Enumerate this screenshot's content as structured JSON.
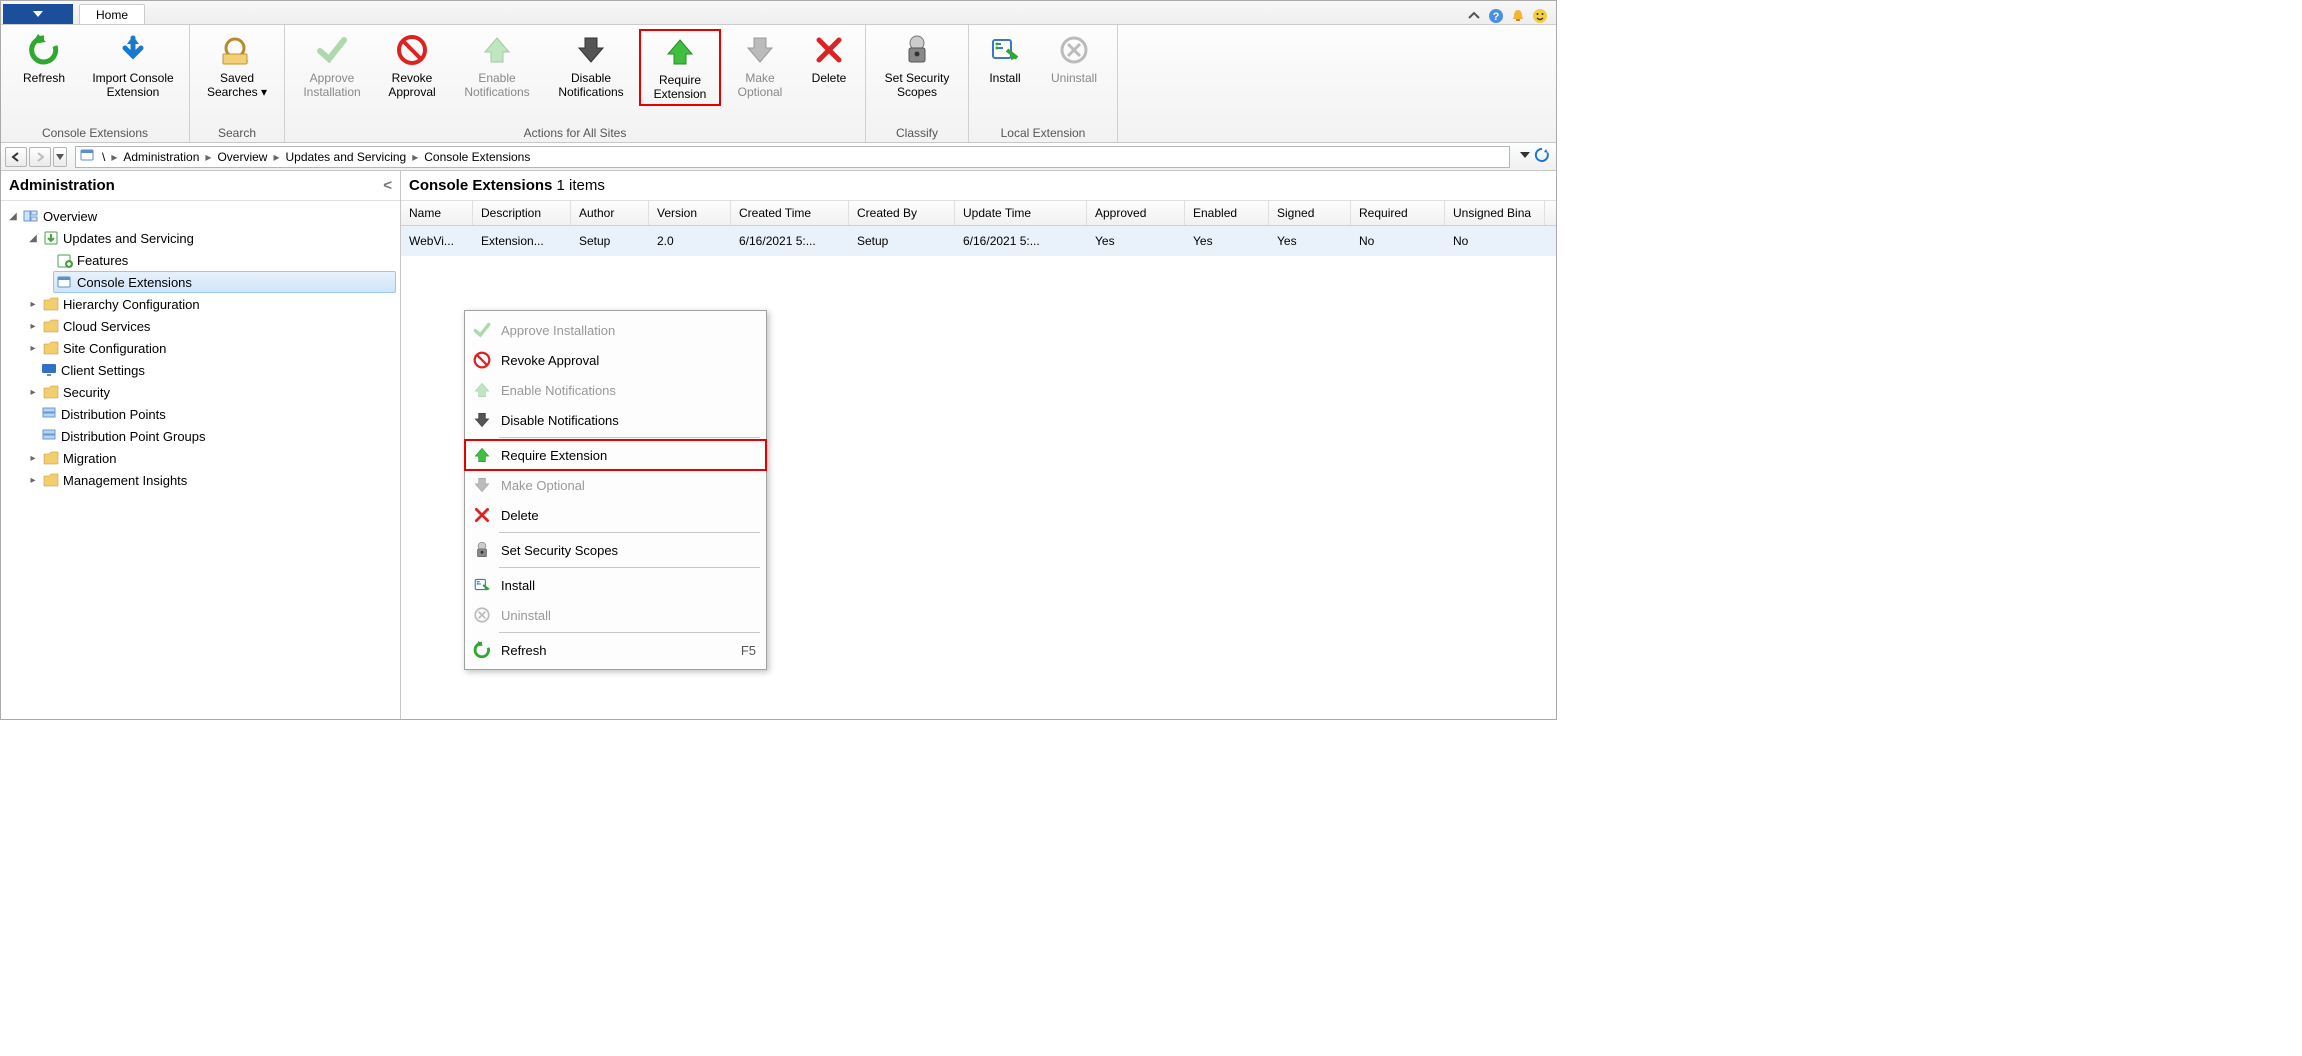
{
  "tabs": {
    "home": "Home"
  },
  "ribbon": {
    "groups": {
      "consoleExt": {
        "label": "Console Extensions",
        "refresh": "Refresh",
        "import": "Import Console Extension"
      },
      "search": {
        "label": "Search",
        "saved": "Saved Searches"
      },
      "actions": {
        "label": "Actions for All Sites",
        "approve": "Approve Installation",
        "revoke": "Revoke Approval",
        "enable": "Enable Notifications",
        "disable": "Disable Notifications",
        "require": "Require Extension",
        "optional": "Make Optional",
        "delete": "Delete"
      },
      "classify": {
        "label": "Classify",
        "scopes": "Set Security Scopes"
      },
      "local": {
        "label": "Local Extension",
        "install": "Install",
        "uninstall": "Uninstall"
      }
    }
  },
  "breadcrumb": [
    "Administration",
    "Overview",
    "Updates and Servicing",
    "Console Extensions"
  ],
  "tree": {
    "header": "Administration",
    "overview": "Overview",
    "updates": "Updates and Servicing",
    "features": "Features",
    "consoleExt": "Console Extensions",
    "hierarchy": "Hierarchy Configuration",
    "cloud": "Cloud Services",
    "siteConfig": "Site Configuration",
    "clientSettings": "Client Settings",
    "security": "Security",
    "distPoints": "Distribution Points",
    "distGroups": "Distribution Point Groups",
    "migration": "Migration",
    "mgmtInsights": "Management Insights"
  },
  "list": {
    "title": "Console Extensions",
    "countLabel": "1 items",
    "columns": [
      "Name",
      "Description",
      "Author",
      "Version",
      "Created Time",
      "Created By",
      "Update Time",
      "Approved",
      "Enabled",
      "Signed",
      "Required",
      "Unsigned Bina"
    ],
    "row": {
      "name": "WebVi...",
      "description": "Extension...",
      "author": "Setup",
      "version": "2.0",
      "created": "6/16/2021 5:...",
      "createdBy": "Setup",
      "updated": "6/16/2021 5:...",
      "approved": "Yes",
      "enabled": "Yes",
      "signed": "Yes",
      "required": "No",
      "unsigned": "No"
    }
  },
  "contextMenu": {
    "approve": "Approve Installation",
    "revoke": "Revoke Approval",
    "enable": "Enable Notifications",
    "disable": "Disable Notifications",
    "require": "Require Extension",
    "optional": "Make Optional",
    "delete": "Delete",
    "scopes": "Set Security Scopes",
    "install": "Install",
    "uninstall": "Uninstall",
    "refresh": "Refresh",
    "refreshKey": "F5"
  }
}
